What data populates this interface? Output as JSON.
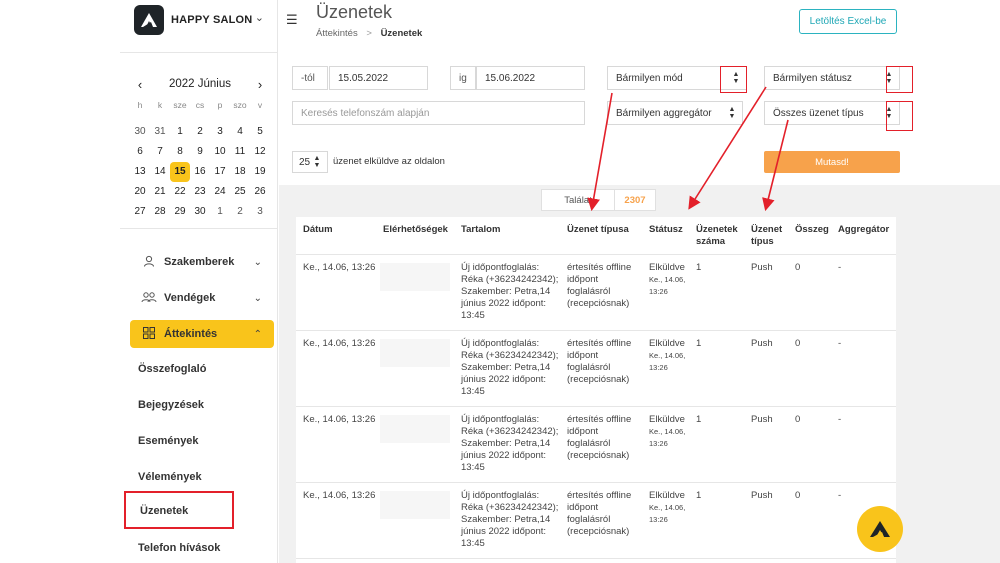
{
  "brand": {
    "name": "HAPPY SALON"
  },
  "calendar": {
    "title": "2022 Június",
    "prev_icon": "chevron-left-icon",
    "next_icon": "chevron-right-icon",
    "weekdays": [
      "h",
      "k",
      "sze",
      "cs",
      "p",
      "szo",
      "v"
    ],
    "days": [
      {
        "d": "30",
        "m": true
      },
      {
        "d": "31",
        "m": true
      },
      {
        "d": "1"
      },
      {
        "d": "2"
      },
      {
        "d": "3"
      },
      {
        "d": "4"
      },
      {
        "d": "5"
      },
      {
        "d": "6"
      },
      {
        "d": "7"
      },
      {
        "d": "8"
      },
      {
        "d": "9"
      },
      {
        "d": "10"
      },
      {
        "d": "11"
      },
      {
        "d": "12"
      },
      {
        "d": "13"
      },
      {
        "d": "14"
      },
      {
        "d": "15",
        "sel": true
      },
      {
        "d": "16"
      },
      {
        "d": "17"
      },
      {
        "d": "18"
      },
      {
        "d": "19"
      },
      {
        "d": "20"
      },
      {
        "d": "21"
      },
      {
        "d": "22"
      },
      {
        "d": "23"
      },
      {
        "d": "24"
      },
      {
        "d": "25"
      },
      {
        "d": "26"
      },
      {
        "d": "27"
      },
      {
        "d": "28"
      },
      {
        "d": "29"
      },
      {
        "d": "30"
      },
      {
        "d": "1",
        "m": true
      },
      {
        "d": "2",
        "m": true
      },
      {
        "d": "3",
        "m": true
      }
    ]
  },
  "nav": {
    "specialists": "Szakemberek",
    "guests": "Vendégek",
    "overview": "Áttekintés",
    "sub": [
      "Összefoglaló",
      "Bejegyzések",
      "Események",
      "Vélemények",
      "Üzenetek",
      "Telefon hívások"
    ]
  },
  "header": {
    "title": "Üzenetek",
    "breadcrumb_parent": "Áttekintés",
    "breadcrumb_sep": ">",
    "breadcrumb_current": "Üzenetek",
    "excel_button": "Letöltés Excel-be"
  },
  "filters": {
    "from_label": "-tól",
    "from_value": "15.05.2022",
    "to_label": "ig",
    "to_value": "15.06.2022",
    "mode": "Bármilyen mód",
    "status": "Bármilyen státusz",
    "aggregator": "Bármilyen aggregátor",
    "message_type": "Összes üzenet típus",
    "phone_placeholder": "Keresés telefonszám alapján",
    "per_page": "25",
    "per_page_label": "üzenet elküldve az oldalon",
    "show_button": "Mutasd!"
  },
  "results": {
    "label": "Találat",
    "count": "2307"
  },
  "table": {
    "headers": [
      "Dátum",
      "Elérhetőségek",
      "Tartalom",
      "Üzenet típusa",
      "Státusz",
      "Üzenetek száma",
      "Üzenet típus",
      "Összeg",
      "Aggregátor"
    ],
    "rows": [
      {
        "date": "Ke., 14.06, 13:26",
        "content": "Új időpontfoglalás: Réka (+36234242342); Szakember: Petra,14 június 2022 időpont: 13:45",
        "type": "értesítés offline időpont foglalásról (recepciósnak)",
        "status": "Elküldve",
        "status_time": "Ke., 14.06, 13:26",
        "count": "1",
        "msg_type": "Push",
        "amount": "0",
        "aggregator": "-"
      },
      {
        "date": "Ke., 14.06, 13:26",
        "content": "Új időpontfoglalás: Réka (+36234242342); Szakember: Petra,14 június 2022 időpont: 13:45",
        "type": "értesítés offline időpont foglalásról (recepciósnak)",
        "status": "Elküldve",
        "status_time": "Ke., 14.06, 13:26",
        "count": "1",
        "msg_type": "Push",
        "amount": "0",
        "aggregator": "-"
      },
      {
        "date": "Ke., 14.06, 13:26",
        "content": "Új időpontfoglalás: Réka (+36234242342); Szakember: Petra,14 június 2022 időpont: 13:45",
        "type": "értesítés offline időpont foglalásról (recepciósnak)",
        "status": "Elküldve",
        "status_time": "Ke., 14.06, 13:26",
        "count": "1",
        "msg_type": "Push",
        "amount": "0",
        "aggregator": "-"
      },
      {
        "date": "Ke., 14.06, 13:26",
        "content": "Új időpontfoglalás: Réka (+36234242342); Szakember: Petra,14 június 2022 időpont: 13:45",
        "type": "értesítés offline időpont foglalásról (recepciósnak)",
        "status": "Elküldve",
        "status_time": "Ke., 14.06, 13:26",
        "count": "1",
        "msg_type": "Push",
        "amount": "0",
        "aggregator": "-"
      }
    ]
  },
  "colors": {
    "accent_yellow": "#f9c41b",
    "show_orange": "#f7a24b",
    "excel_teal": "#1ea7b5",
    "annotation_red": "#e3202a"
  }
}
